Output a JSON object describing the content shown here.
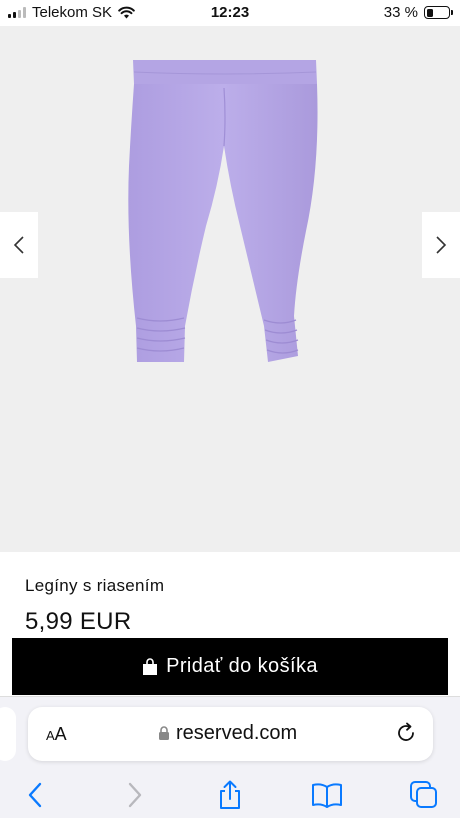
{
  "status_bar": {
    "carrier": "Telekom SK",
    "time": "12:23",
    "battery_percent": "33 %",
    "battery_level": 0.33,
    "icons": [
      "signal-icon",
      "wifi-icon",
      "battery-icon"
    ]
  },
  "gallery": {
    "product_color": "#b7a8e6",
    "background_color": "#efefef",
    "prev_icon": "chevron-left-icon",
    "next_icon": "chevron-right-icon"
  },
  "product": {
    "name": "Legíny s riasením",
    "price": "5,99 EUR",
    "add_to_cart_label": "Pridať do košíka",
    "add_to_cart_icon": "shopping-bag-icon"
  },
  "browser": {
    "text_size_label_small": "A",
    "text_size_label_large": "A",
    "url": "reserved.com",
    "lock_icon": "lock-icon",
    "reload_icon": "reload-icon",
    "toolbar_icons": [
      "back-icon",
      "forward-icon",
      "share-icon",
      "bookmarks-icon",
      "tabs-icon"
    ],
    "accent_color": "#0a7aff"
  }
}
